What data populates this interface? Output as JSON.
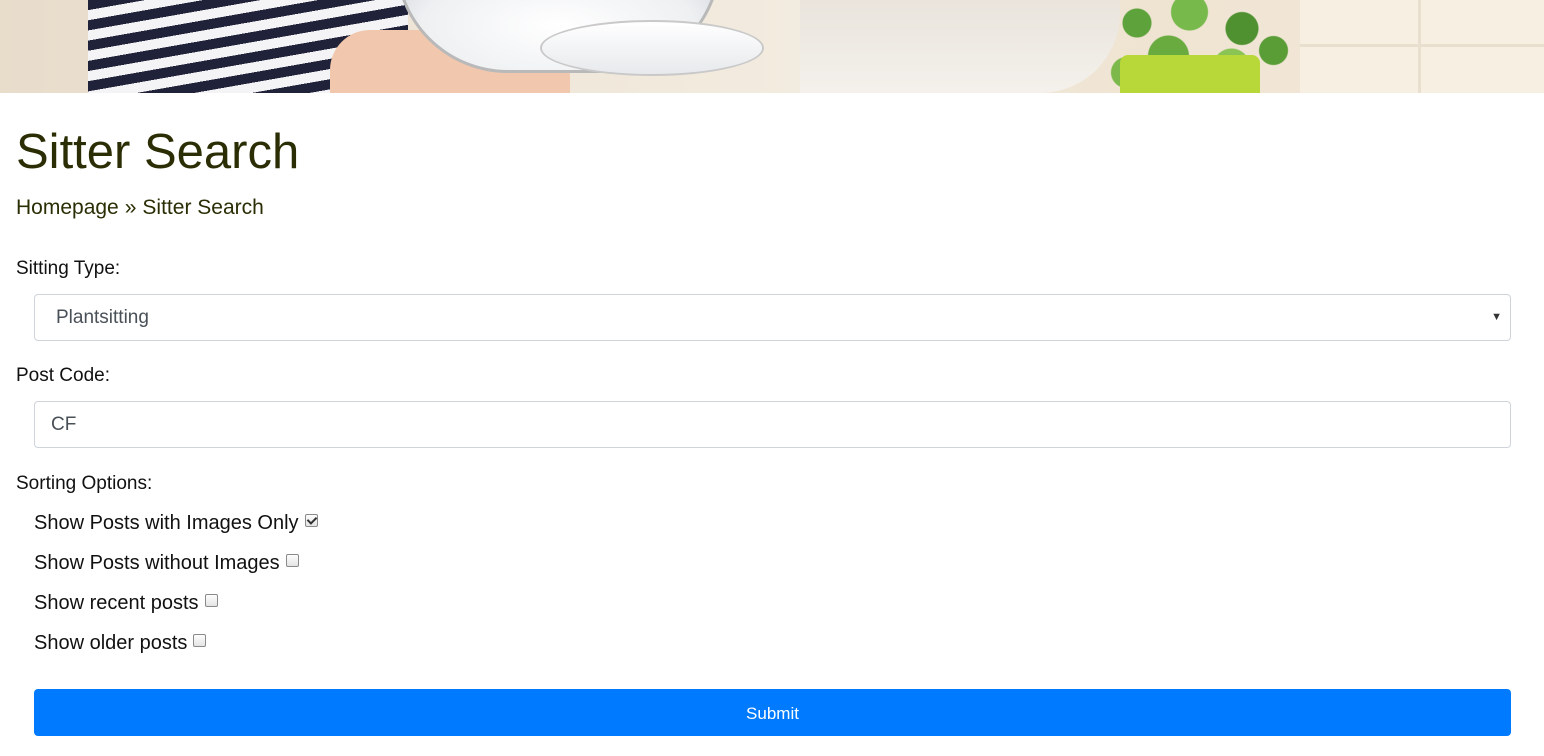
{
  "page": {
    "title": "Sitter Search"
  },
  "breadcrumb": {
    "home": "Homepage",
    "separator": "»",
    "current": "Sitter Search"
  },
  "form": {
    "sitting_type": {
      "label": "Sitting Type:",
      "selected": "Plantsitting"
    },
    "post_code": {
      "label": "Post Code:",
      "value": "CF"
    },
    "sorting": {
      "label": "Sorting Options:",
      "options": [
        {
          "label": "Show Posts with Images Only",
          "checked": true
        },
        {
          "label": "Show Posts without Images",
          "checked": false
        },
        {
          "label": "Show recent posts",
          "checked": false
        },
        {
          "label": "Show older posts",
          "checked": false
        }
      ]
    },
    "submit_label": "Submit"
  },
  "colors": {
    "heading": "#2b2e04",
    "submit_bg": "#007bff",
    "submit_text": "#ffffff"
  }
}
